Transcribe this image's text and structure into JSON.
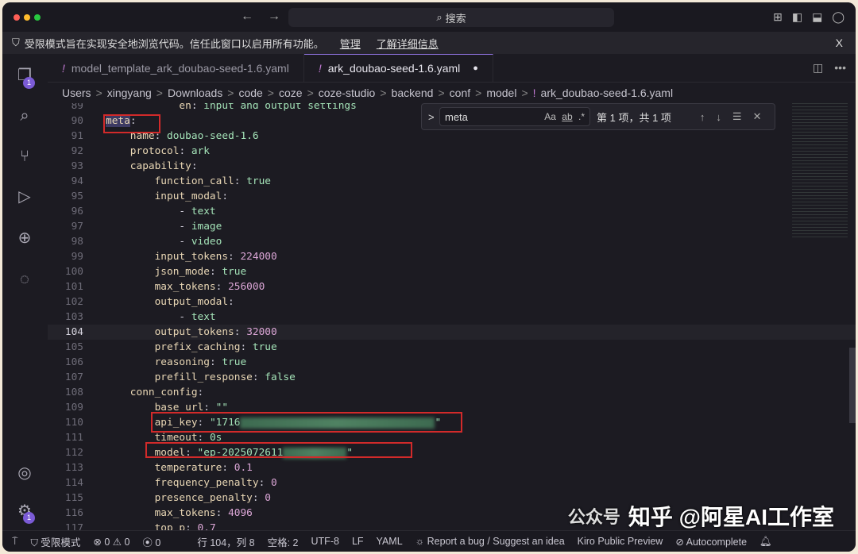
{
  "titlebar": {
    "search": "搜索",
    "search_icon": "search-icon"
  },
  "banner": {
    "message": "受限模式旨在实现安全地浏览代码。信任此窗口以启用所有功能。",
    "manage": "管理",
    "learn_more": "了解详细信息",
    "close": "X"
  },
  "activity": {
    "explorer_badge": "1",
    "settings_badge": "1"
  },
  "tabs": [
    {
      "label": "model_template_ark_doubao-seed-1.6.yaml",
      "icon": "!"
    },
    {
      "label": "ark_doubao-seed-1.6.yaml",
      "icon": "!",
      "dirty": "●"
    }
  ],
  "breadcrumb": [
    "Users",
    "xingyang",
    "Downloads",
    "code",
    "coze",
    "coze-studio",
    "backend",
    "conf",
    "model",
    "ark_doubao-seed-1.6.yaml"
  ],
  "breadcrumb_sep": ">",
  "find": {
    "value": "meta",
    "match_case": "Aa",
    "whole_word": "ab",
    "regex": ".*",
    "result": "第 1 项，共 1 项",
    "expand": ">",
    "prev": "↑",
    "next": "↓",
    "selection": "☰",
    "close": "✕"
  },
  "code": {
    "lines": [
      {
        "n": "89",
        "i": 3,
        "k": "en",
        "v": "input and output settings",
        "t": "s"
      },
      {
        "n": "90",
        "i": 0,
        "k": "meta",
        "v": "",
        "t": "s"
      },
      {
        "n": "91",
        "i": 1,
        "k": "name",
        "v": "doubao-seed-1.6",
        "t": "s"
      },
      {
        "n": "92",
        "i": 1,
        "k": "protocol",
        "v": "ark",
        "t": "s"
      },
      {
        "n": "93",
        "i": 1,
        "k": "capability",
        "v": "",
        "t": "s"
      },
      {
        "n": "94",
        "i": 2,
        "k": "function_call",
        "v": "true",
        "t": "s"
      },
      {
        "n": "95",
        "i": 2,
        "k": "input_modal",
        "v": "",
        "t": "s"
      },
      {
        "n": "96",
        "i": 3,
        "k": "",
        "v": "text",
        "t": "s",
        "dash": "- "
      },
      {
        "n": "97",
        "i": 3,
        "k": "",
        "v": "image",
        "t": "s",
        "dash": "- "
      },
      {
        "n": "98",
        "i": 3,
        "k": "",
        "v": "video",
        "t": "s",
        "dash": "- "
      },
      {
        "n": "99",
        "i": 2,
        "k": "input_tokens",
        "v": "224000",
        "t": "n"
      },
      {
        "n": "100",
        "i": 2,
        "k": "json_mode",
        "v": "true",
        "t": "s"
      },
      {
        "n": "101",
        "i": 2,
        "k": "max_tokens",
        "v": "256000",
        "t": "n"
      },
      {
        "n": "102",
        "i": 2,
        "k": "output_modal",
        "v": "",
        "t": "s"
      },
      {
        "n": "103",
        "i": 3,
        "k": "",
        "v": "text",
        "t": "s",
        "dash": "- "
      },
      {
        "n": "104",
        "i": 2,
        "k": "output_tokens",
        "v": "32000",
        "t": "n"
      },
      {
        "n": "105",
        "i": 2,
        "k": "prefix_caching",
        "v": "true",
        "t": "s"
      },
      {
        "n": "106",
        "i": 2,
        "k": "reasoning",
        "v": "true",
        "t": "s"
      },
      {
        "n": "107",
        "i": 2,
        "k": "prefill_response",
        "v": "false",
        "t": "s"
      },
      {
        "n": "108",
        "i": 1,
        "k": "conn_config",
        "v": "",
        "t": "s"
      },
      {
        "n": "109",
        "i": 2,
        "k": "base_url",
        "v": "\"\"",
        "t": "s"
      },
      {
        "n": "110",
        "i": 2,
        "k": "api_key",
        "v": "\"1716",
        "t": "s",
        "blur": "wide",
        "tail": "\""
      },
      {
        "n": "111",
        "i": 2,
        "k": "timeout",
        "v": "0s",
        "t": "s"
      },
      {
        "n": "112",
        "i": 2,
        "k": "model",
        "v": "\"ep-2025072611",
        "t": "s",
        "blur": "short",
        "tail": "\""
      },
      {
        "n": "113",
        "i": 2,
        "k": "temperature",
        "v": "0.1",
        "t": "n"
      },
      {
        "n": "114",
        "i": 2,
        "k": "frequency_penalty",
        "v": "0",
        "t": "n"
      },
      {
        "n": "115",
        "i": 2,
        "k": "presence_penalty",
        "v": "0",
        "t": "n"
      },
      {
        "n": "116",
        "i": 2,
        "k": "max_tokens",
        "v": "4096",
        "t": "n"
      },
      {
        "n": "117",
        "i": 2,
        "k": "top_p",
        "v": "0.7",
        "t": "n"
      }
    ],
    "current_line": "104"
  },
  "status": {
    "mode": "受限模式",
    "errors": "0",
    "warnings": "0",
    "ports": "0",
    "position": "行 104，列 8",
    "spaces": "空格: 2",
    "encoding": "UTF-8",
    "eol": "LF",
    "language": "YAML",
    "report": "Report a bug / Suggest an idea",
    "preview": "Kiro Public Preview",
    "autocomplete": "Autocomplete"
  },
  "watermark": {
    "wechat": "公众号",
    "text": "知乎 @阿星AI工作室"
  }
}
